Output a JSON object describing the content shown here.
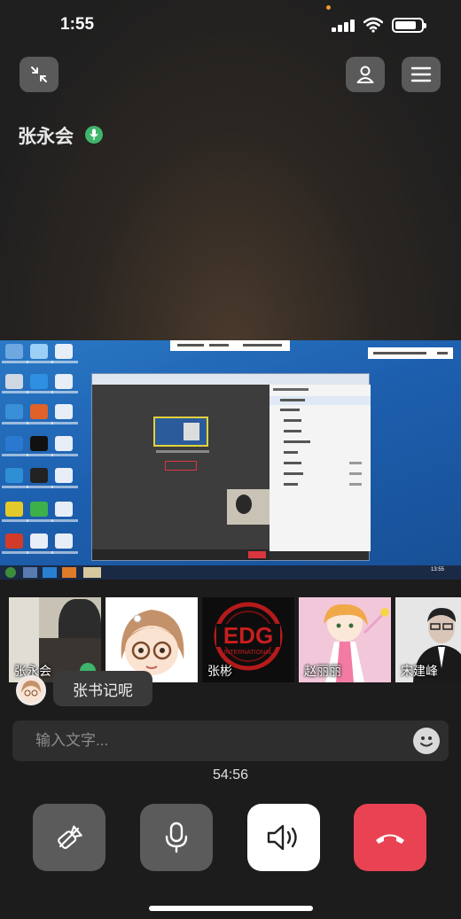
{
  "status": {
    "time": "1:55",
    "battery_level": 0.82
  },
  "header": {
    "exit_fullscreen_icon": "collapse-arrows-icon",
    "profile_icon": "person-icon",
    "menu_icon": "hamburger-menu-icon",
    "speaker_name": "张永会",
    "speaker_mic_icon": "microphone-icon"
  },
  "shared_screen": {
    "type": "remote desktop share",
    "taskbar_clock": "13:55"
  },
  "participants": [
    {
      "name": "张永会",
      "mic_active": true
    },
    {
      "name": ""
    },
    {
      "name": "张彬"
    },
    {
      "name": "赵丽丽"
    },
    {
      "name": "宋建峰"
    }
  ],
  "chat": {
    "message": "张书记呢"
  },
  "input": {
    "placeholder": "输入文字...",
    "emoji_icon": "smiley-face-icon"
  },
  "call": {
    "duration": "54:56"
  },
  "controls": {
    "mute_video_icon": "camera-off-icon",
    "mic_icon": "microphone-icon",
    "speaker_icon": "speaker-icon",
    "hangup_icon": "hang-up-phone-icon",
    "colors": {
      "button_gray": "#5b5b5b",
      "speaker_active": "#ffffff",
      "hangup": "#e94353",
      "mic_green": "#3fb46b"
    }
  }
}
